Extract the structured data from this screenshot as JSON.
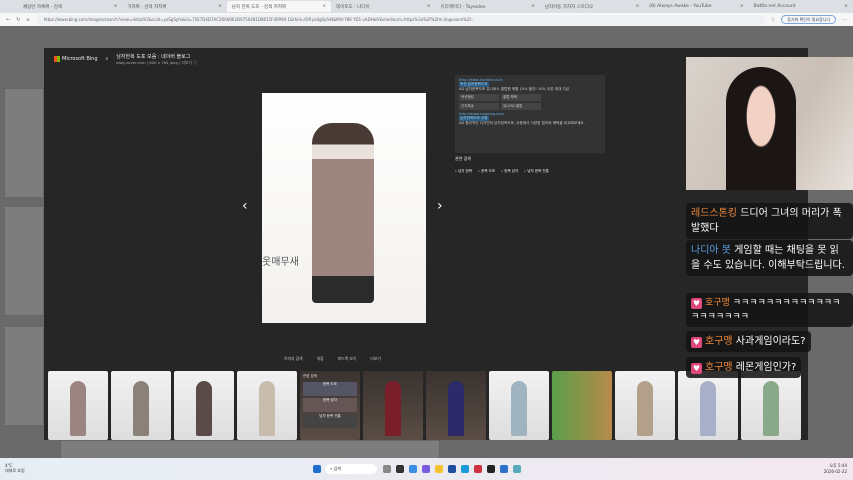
{
  "browser": {
    "tabs": [
      {
        "label": "채팅탄 자체짜 - 검색"
      },
      {
        "label": "가져짜 - 검색 저저짜"
      },
      {
        "label": "남자 한복 도포 - 검색 저저짜",
        "active": true
      },
      {
        "label": "데이토도 - 나다이"
      },
      {
        "label": "유리계이다 - Toyeolen"
      },
      {
        "label": "남자아동 자자자 스토디오"
      },
      {
        "label": "(8) Always Awake - YouTube"
      },
      {
        "label": "Battle.net Account"
      }
    ],
    "url": "https://www.bing.com/images/search?view=detailV2&ccid=yoSgSyfv&id=75E7D4D7AC26A0062D6750481D8615F40994 1&thid=OIP.yoSgSyfvN&MVr786 YD1 uADHwV&mediaurl=https%3a%2f%2fm.lingusonn%2f...",
    "sync_pill": "동기화 확인이 필요합니다"
  },
  "viewer": {
    "brand": "Microsoft Bing",
    "title": "남자한복 도포 모음 : 네이버 블로그",
    "source": "blog.naver.com",
    "size": "600 x 784 jpeg",
    "more": "더보기 ⓘ",
    "image_caption": "옷매무새",
    "side": {
      "ad1": {
        "url": "http://www.auction.co.kr",
        "title": "옥션 남자한복도포",
        "desc": "AD 남자한복도포 유니버스 클럽원 매월 10% 할인! 10% 쿠폰 최대 지급",
        "chips": [
          "옥션랭킹",
          "클럽 혜택",
          "신차특송",
          "유니버스클럽"
        ]
      },
      "ad2": {
        "url": "http://www.coupang.com",
        "title": "남자한복도포 쿠팡",
        "desc": "AD 합리적인 디자인의 남자한복도포, 쿠팡에서 다양한 컬러와 혜택을 비교해보세요."
      }
    },
    "related": {
      "title": "관련 검색",
      "items": [
        "남자 한복",
        "한복 도포",
        "한복 남자",
        "남자 한복 전통"
      ]
    },
    "actions": [
      "이미지 검색",
      "저장",
      "피드백 보기",
      "더보기"
    ],
    "related_tile": {
      "title": "관련 검색",
      "items": [
        "한복 도포",
        "한복 남자",
        "남자 한복 전통"
      ]
    }
  },
  "chat": [
    {
      "user": "레드스톤킹",
      "user_color": "#f08a3c",
      "text": "드디어 그녀의 머리가 폭발했다"
    },
    {
      "user": "나디아 봇",
      "user_color": "#5aa0e6",
      "text": "게임할 때는 채팅을 못 읽을 수도 있습니다. 이해부탁드립니다."
    },
    {
      "user": "호구맹",
      "user_color": "#f08a3c",
      "text": "ㅋㅋㅋㅋㅋㅋㅋㅋㅋㅋㅋㅋㅋㅋㅋㅋㅋㅋㅋㅋ"
    },
    {
      "user": "호구맹",
      "user_color": "#f08a3c",
      "text": "사과게임이라도?"
    },
    {
      "user": "호구맹",
      "user_color": "#f08a3c",
      "text": "레몬게임인가?"
    }
  ],
  "taskbar": {
    "weather": "4°C",
    "weather_desc": "대체로 흐림",
    "search": "검색",
    "time": "오후 5:44",
    "date": "2026-02-22"
  }
}
